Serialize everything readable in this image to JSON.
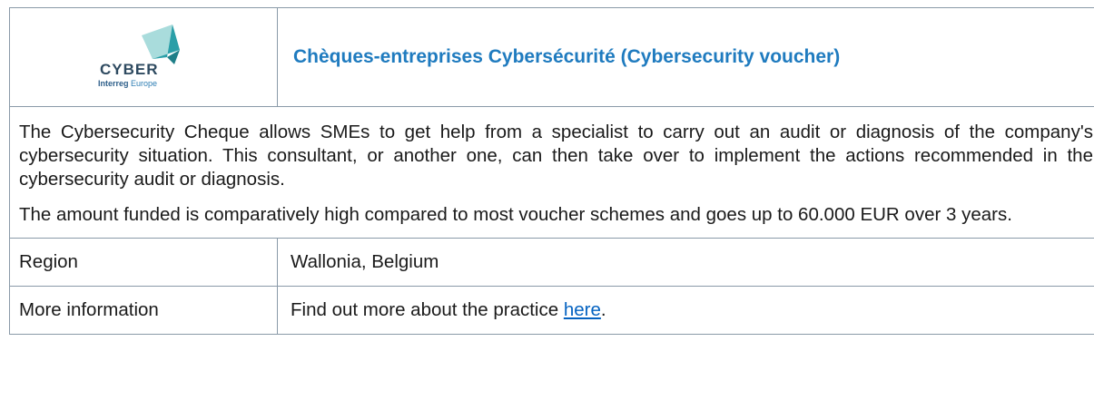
{
  "logo": {
    "word": "CYBER",
    "sub_bold": "Interreg",
    "sub_rest": "Europe",
    "colors": {
      "teal_light": "#8fd0d0",
      "teal_dark": "#2a9fa8",
      "navy": "#2e4a60"
    }
  },
  "header": {
    "title": "Chèques-entreprises Cybersécurité (Cybersecurity voucher)"
  },
  "description": {
    "paragraphs": [
      "The Cybersecurity Cheque allows SMEs to get help from a specialist to carry out an audit or diagnosis of the company's cybersecurity situation. This consultant, or another one, can then take over to implement the actions recommended in the cybersecurity audit or diagnosis.",
      "The amount funded is comparatively high compared to most voucher schemes and goes up to 60.000 EUR over 3 years."
    ]
  },
  "rows": {
    "region": {
      "label": "Region",
      "value": "Wallonia, Belgium"
    },
    "more_info": {
      "label": "More information",
      "text_before": "Find out more about the practice ",
      "link_text": "here",
      "text_after": "."
    }
  },
  "colors": {
    "title": "#1f7bbf",
    "border": "#8a9aa8",
    "link": "#0563c1"
  }
}
